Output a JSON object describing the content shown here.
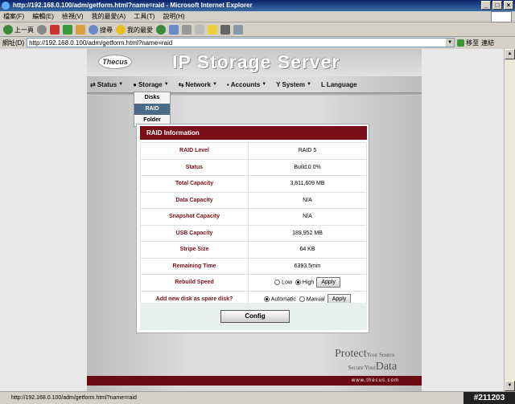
{
  "window": {
    "title": "http://192.168.0.100/adm/getform.html?name=raid - Microsoft Internet Explorer"
  },
  "menu": [
    "檔案(F)",
    "編輯(E)",
    "檢視(V)",
    "我的最愛(A)",
    "工具(T)",
    "說明(H)"
  ],
  "toolbar": {
    "back": "上一頁",
    "search": "搜尋",
    "favorites": "我的最愛"
  },
  "address": {
    "label": "網址(D)",
    "url": "http://192.168.0.100/adm/getform.html?name=raid",
    "go": "移至",
    "links": "連結"
  },
  "status": {
    "text": "http://192.168.0.100/adm/getform.html?name=raid",
    "watermark": "#211203"
  },
  "brand": {
    "logo": "Thecus",
    "title": "IP Storage Server"
  },
  "nav": [
    {
      "label": "Status"
    },
    {
      "label": "Storage"
    },
    {
      "label": "Network"
    },
    {
      "label": "Accounts"
    },
    {
      "label": "System"
    },
    {
      "label": "Language"
    }
  ],
  "storage_menu": [
    "Disks",
    "RAID",
    "Folder"
  ],
  "raid": {
    "header": "RAID Information",
    "rows": [
      {
        "label": "RAID Level",
        "value": "RAID 5"
      },
      {
        "label": "Status",
        "value": "Build:0.0%"
      },
      {
        "label": "Total Capacity",
        "value": "3,811,609 MB"
      },
      {
        "label": "Data Capacity",
        "value": "N/A"
      },
      {
        "label": "Snapshot Capacity",
        "value": "N/A"
      },
      {
        "label": "USB Capacity",
        "value": "189,952 MB"
      },
      {
        "label": "Stripe Size",
        "value": "64 KB"
      },
      {
        "label": "Remaining Time",
        "value": "6393.5min"
      }
    ],
    "rebuild": {
      "label": "Rebuild Speed",
      "low": "Low",
      "high": "High",
      "apply": "Apply",
      "selected": "High"
    },
    "spare": {
      "label": "Add new disk as spare disk?",
      "automatic": "Automatic",
      "manual": "Manual",
      "apply": "Apply",
      "selected": "Automatic"
    },
    "config": "Config"
  },
  "footer": {
    "protect": "Protect",
    "your_source": "Your Source",
    "secure_your": "Secure Your",
    "data": "Data",
    "url": "www.thecus.com"
  }
}
